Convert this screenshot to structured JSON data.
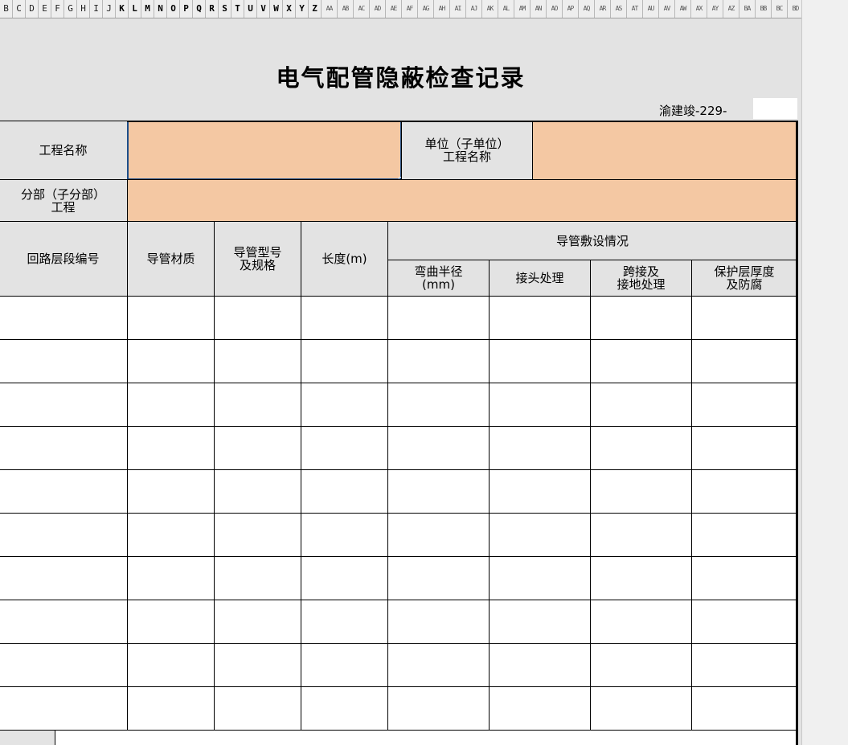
{
  "column_headers": [
    "B",
    "C",
    "D",
    "E",
    "F",
    "G",
    "H",
    "I",
    "J",
    "K",
    "L",
    "M",
    "N",
    "O",
    "P",
    "Q",
    "R",
    "S",
    "T",
    "U",
    "V",
    "W",
    "X",
    "Y",
    "Z",
    "AA",
    "AB",
    "AC",
    "AD",
    "AE",
    "AF",
    "AG",
    "AH",
    "AI",
    "AJ",
    "AK",
    "AL",
    "AM",
    "AN",
    "AO",
    "AP",
    "AQ",
    "AR",
    "AS",
    "AT",
    "AU",
    "AV",
    "AW",
    "AX",
    "AY",
    "AZ",
    "BA",
    "BB",
    "BC",
    "BD"
  ],
  "title": "电气配管隐蔽检查记录",
  "doc_number_label": "渝建竣-229-",
  "form": {
    "project_name_label": "工程名称",
    "project_name_value": "",
    "unit_project_label_line1": "单位（子单位）",
    "unit_project_label_line2": "工程名称",
    "unit_project_value": "",
    "division_label_line1": "分部（子分部）",
    "division_label_line2": "工程",
    "division_value": ""
  },
  "table": {
    "headers": {
      "circuit": "回路层段编号",
      "material": "导管材质",
      "model_line1": "导管型号",
      "model_line2": "及规格",
      "length": "长度(m)",
      "laying_group": "导管敷设情况",
      "bend_line1": "弯曲半径",
      "bend_line2": "(mm)",
      "joint": "接头处理",
      "cross_line1": "跨接及",
      "cross_line2": "接地处理",
      "protect_line1": "保护层厚度",
      "protect_line2": "及防腐"
    },
    "row_count": 10
  }
}
